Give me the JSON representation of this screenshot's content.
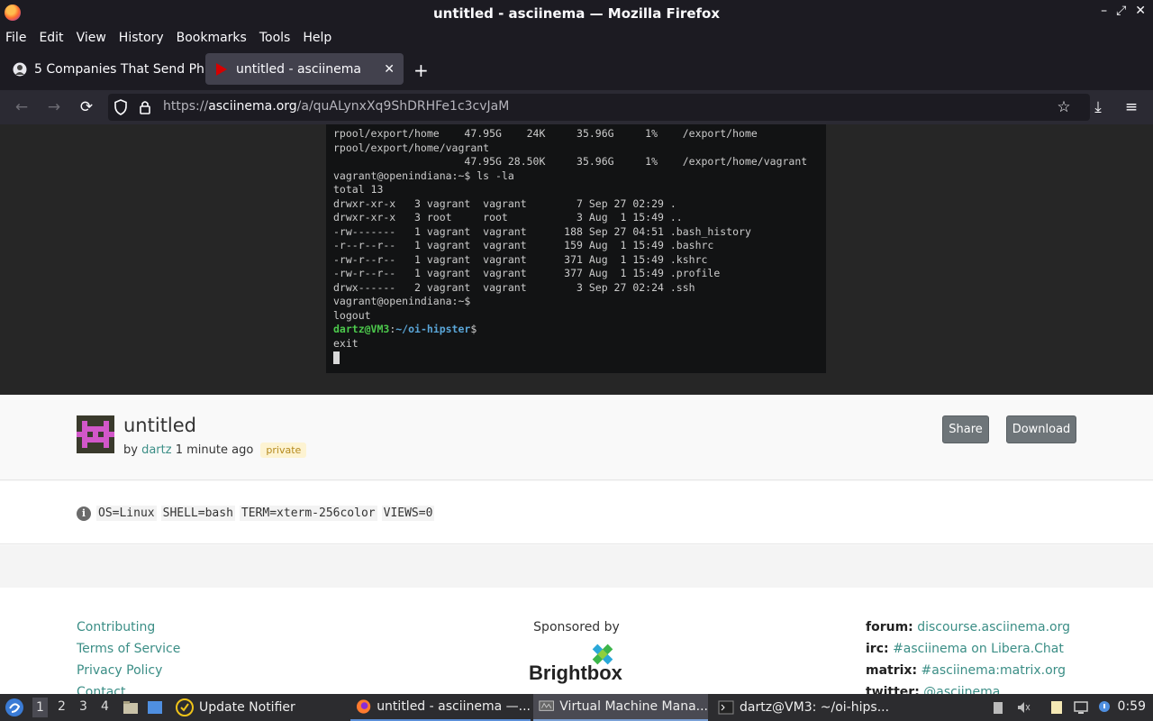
{
  "window": {
    "title": "untitled - asciinema — Mozilla Firefox",
    "controls": [
      "–",
      "⤢",
      "✕"
    ]
  },
  "menu": [
    "File",
    "Edit",
    "View",
    "History",
    "Bookmarks",
    "Tools",
    "Help"
  ],
  "tabs": [
    {
      "label": "5 Companies That Send Ph",
      "active": false
    },
    {
      "label": "untitled - asciinema",
      "active": true,
      "close": "✕"
    }
  ],
  "newtab": "+",
  "nav": {
    "back": "←",
    "forward": "→",
    "reload": "⟳",
    "url_prefix": "https://",
    "url_host": "asciinema.org",
    "url_path": "/a/quALynxXq9ShDRHFe1c3cvJaM",
    "bookmark": "☆",
    "download": "⤓",
    "menu": "≡"
  },
  "terminal": {
    "lines": [
      "rpool/export/home    47.95G    24K     35.96G     1%    /export/home",
      "rpool/export/home/vagrant",
      "                     47.95G 28.50K     35.96G     1%    /export/home/vagrant",
      "vagrant@openindiana:~$ ls -la",
      "total 13",
      "drwxr-xr-x   3 vagrant  vagrant        7 Sep 27 02:29 .",
      "drwxr-xr-x   3 root     root           3 Aug  1 15:49 ..",
      "-rw-------   1 vagrant  vagrant      188 Sep 27 04:51 .bash_history",
      "-r--r--r--   1 vagrant  vagrant      159 Aug  1 15:49 .bashrc",
      "-rw-r--r--   1 vagrant  vagrant      371 Aug  1 15:49 .kshrc",
      "-rw-r--r--   1 vagrant  vagrant      377 Aug  1 15:49 .profile",
      "drwx------   2 vagrant  vagrant        3 Sep 27 02:24 .ssh",
      "vagrant@openindiana:~$",
      "logout"
    ],
    "prompt_user": "dartz@VM3",
    "prompt_sep": ":",
    "prompt_path": "~/oi-hipster",
    "prompt_end": "$",
    "last_line": "exit"
  },
  "recording": {
    "title": "untitled",
    "by": "by",
    "author": "dartz",
    "time": "1 minute ago",
    "badge": "private",
    "share": "Share",
    "download": "Download"
  },
  "meta": {
    "info_glyph": "i",
    "tags": [
      "OS=Linux",
      "SHELL=bash",
      "TERM=xterm-256color",
      "VIEWS=0"
    ]
  },
  "footer": {
    "links": [
      "Contributing",
      "Terms of Service",
      "Privacy Policy",
      "Contact"
    ],
    "sponsored_by": "Sponsored by",
    "sponsor_name": "Brightbox",
    "social": [
      {
        "label": "forum:",
        "value": "discourse.asciinema.org"
      },
      {
        "label": "irc:",
        "value": "#asciinema on Libera.Chat"
      },
      {
        "label": "matrix:",
        "value": "#asciinema:matrix.org"
      },
      {
        "label": "twitter:",
        "value": "@asciinema"
      }
    ]
  },
  "taskbar": {
    "workspaces": [
      "1",
      "2",
      "3",
      "4"
    ],
    "tasks": [
      {
        "label": "Update Notifier"
      },
      {
        "label": "untitled - asciinema —..."
      },
      {
        "label": "Virtual Machine Mana..."
      },
      {
        "label": "dartz@VM3: ~/oi-hips..."
      }
    ],
    "clock": "0:59"
  },
  "colors": {
    "accent_link": "#3b8e86",
    "terminal_bg": "#121314",
    "browser_chrome": "#1c1b22"
  }
}
